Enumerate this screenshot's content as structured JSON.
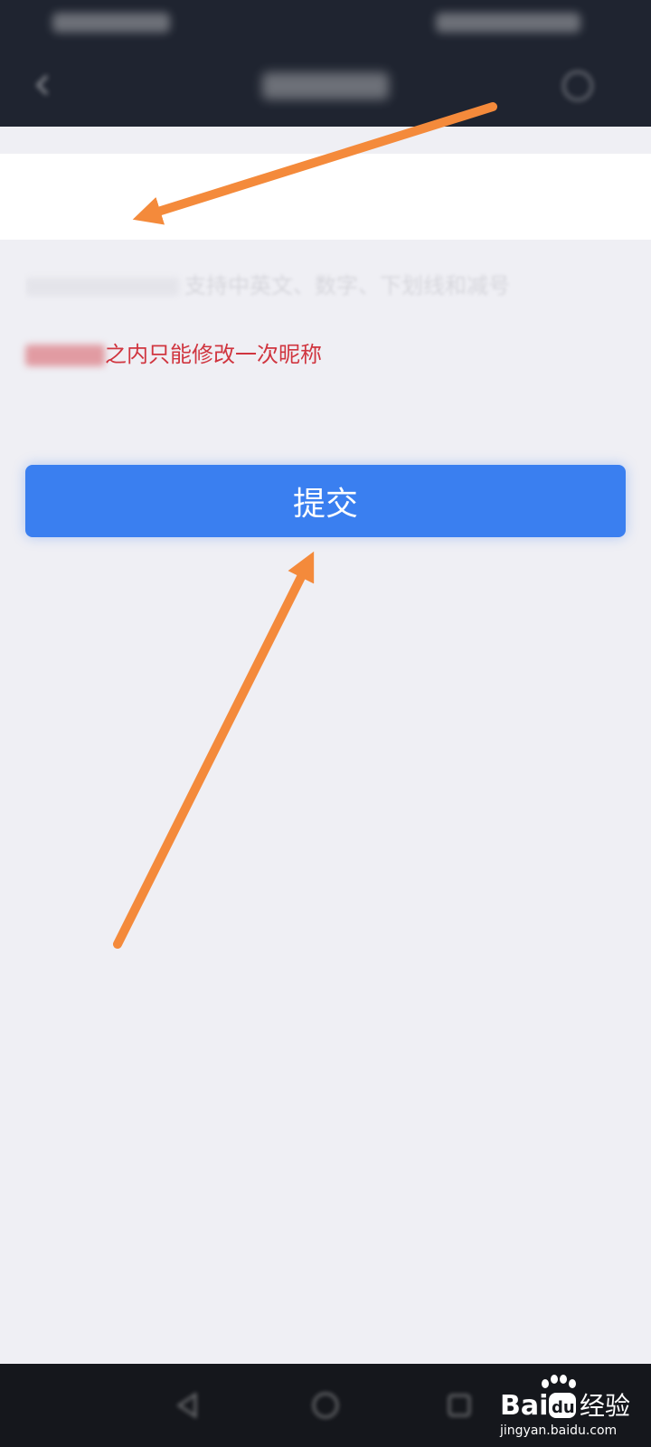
{
  "nickname_input": {
    "value": "",
    "placeholder": ""
  },
  "hint": {
    "text": "支持中英文、数字、下划线和减号"
  },
  "warning": {
    "text": "之内只能修改一次昵称"
  },
  "submit": {
    "label": "提交"
  },
  "watermark": {
    "site": "jingyan.baidu.com"
  },
  "colors": {
    "accent": "#3a7ff0",
    "warning": "#d0353f",
    "header": "#1f2430",
    "arrow": "#f48a3b"
  }
}
